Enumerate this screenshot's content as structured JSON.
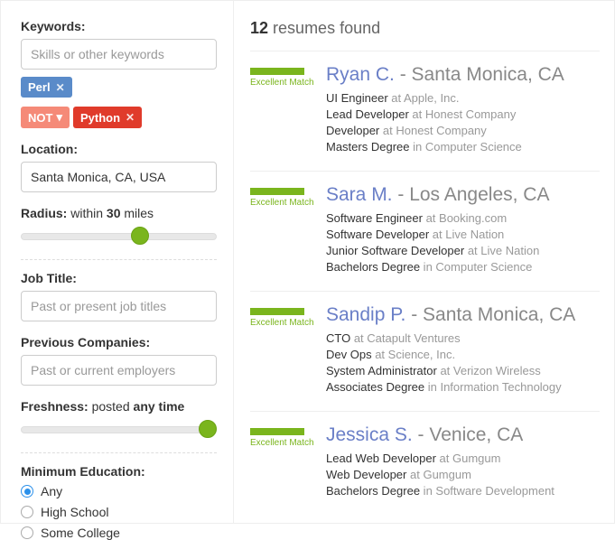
{
  "results_count": "12",
  "results_suffix": "resumes found",
  "sidebar": {
    "keywords_label": "Keywords:",
    "keywords_placeholder": "Skills or other keywords",
    "tag_perl": "Perl",
    "tag_not": "NOT",
    "tag_python": "Python",
    "location_label": "Location:",
    "location_value": "Santa Monica, CA, USA",
    "radius_label": "Radius:",
    "radius_pre": "within ",
    "radius_num": "30",
    "radius_post": " miles",
    "jobtitle_label": "Job Title:",
    "jobtitle_placeholder": "Past or present job titles",
    "prevco_label": "Previous Companies:",
    "prevco_placeholder": "Past or current employers",
    "freshness_label": "Freshness:",
    "freshness_pre": "posted ",
    "freshness_bold": "any time",
    "edu_label": "Minimum Education:",
    "edu0": "Any",
    "edu1": "High School",
    "edu2": "Some College"
  },
  "match_label": "Excellent Match",
  "sep": " - ",
  "at": " at ",
  "inw": " in ",
  "r": [
    {
      "name": "Ryan C.",
      "loc": "Santa Monica, CA",
      "l0t": "UI Engineer",
      "l0o": "Apple, Inc.",
      "l1t": "Lead Developer",
      "l1o": "Honest Company",
      "l2t": "Developer",
      "l2o": "Honest Company",
      "l3t": "Masters Degree",
      "l3o": "Computer Science"
    },
    {
      "name": "Sara M.",
      "loc": "Los Angeles, CA",
      "l0t": "Software Engineer",
      "l0o": "Booking.com",
      "l1t": "Software Developer",
      "l1o": "Live Nation",
      "l2t": "Junior Software Developer",
      "l2o": "Live Nation",
      "l3t": "Bachelors Degree",
      "l3o": "Computer Science"
    },
    {
      "name": "Sandip P.",
      "loc": "Santa Monica, CA",
      "l0t": "CTO",
      "l0o": "Catapult Ventures",
      "l1t": "Dev Ops",
      "l1o": "Science, Inc.",
      "l2t": "System Administrator",
      "l2o": "Verizon Wireless",
      "l3t": "Associates Degree",
      "l3o": "Information Technology"
    },
    {
      "name": "Jessica S.",
      "loc": "Venice, CA",
      "l0t": "Lead Web Developer",
      "l0o": "Gumgum",
      "l1t": "Web Developer",
      "l1o": "Gumgum",
      "l2t": "Bachelors Degree",
      "l2o": "Software Development"
    }
  ]
}
